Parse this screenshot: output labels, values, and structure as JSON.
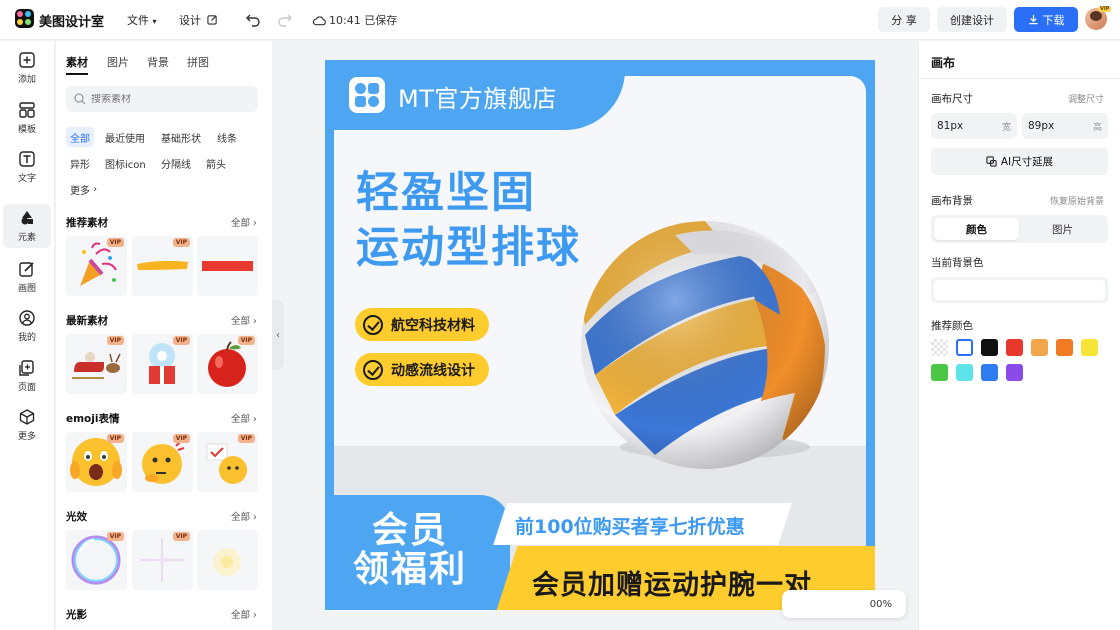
{
  "app": {
    "name": "美图设计室"
  },
  "topbar": {
    "file_menu": "文件",
    "design_menu": "设计",
    "save_status": "10:41 已保存",
    "share_label": "分 享",
    "create_label": "创建设计",
    "download_label": "下载",
    "avatar_badge": "VIP"
  },
  "rail": [
    {
      "label": "添加",
      "icon": "plus-square-icon"
    },
    {
      "label": "模板",
      "icon": "template-icon"
    },
    {
      "label": "文字",
      "icon": "text-icon"
    },
    {
      "label": "元素",
      "icon": "shapes-icon",
      "active": true
    },
    {
      "label": "画图",
      "icon": "draw-icon"
    },
    {
      "label": "我的",
      "icon": "user-icon"
    },
    {
      "label": "页面",
      "icon": "page-add-icon"
    },
    {
      "label": "更多",
      "icon": "cube-icon"
    }
  ],
  "panel": {
    "tabs": [
      "素材",
      "图片",
      "背景",
      "拼图"
    ],
    "search_placeholder": "搜索素材",
    "chips": [
      "全部",
      "最近使用",
      "基础形状",
      "线条",
      "异形",
      "图标icon",
      "分隔线",
      "箭头",
      "更多"
    ],
    "all_label": "全部",
    "vip_badge": "VIP",
    "sections": [
      {
        "title": "推荐素材"
      },
      {
        "title": "最新素材"
      },
      {
        "title": "emoji表情"
      },
      {
        "title": "光效"
      },
      {
        "title": "光影"
      }
    ]
  },
  "poster": {
    "store_name": "MT官方旗舰店",
    "headline_1": "轻盈坚固",
    "headline_2": "运动型排球",
    "feature_1": "航空科技材料",
    "feature_2": "动感流线设计",
    "promo_left": "会员\n领福利",
    "promo_top": "前100位购买者享七折优惠",
    "promo_bottom": "会员加赠运动护腕一对"
  },
  "zoom": {
    "value": "00%"
  },
  "props": {
    "title": "画布",
    "size_label": "画布尺寸",
    "size_link": "调整尺寸",
    "width_value": "81px",
    "width_unit": "宽",
    "height_value": "89px",
    "height_unit": "高",
    "ai_button": "AI尺寸延展",
    "bg_label": "画布背景",
    "bg_reset": "恢复原始背景",
    "seg_color": "颜色",
    "seg_image": "图片",
    "current_color_label": "当前背景色",
    "recommended_label": "推荐颜色",
    "swatches": [
      "transparent",
      "#ffffff",
      "#111111",
      "#e8392f",
      "#f2a64b",
      "#f07b22",
      "#f5e536",
      "#4cc645",
      "#5ce4e8",
      "#2f7bf0",
      "#8a4be8"
    ]
  },
  "colors": {
    "accent": "#2b6ff6",
    "poster_blue": "#4ea6f2",
    "poster_yellow": "#ffcc2e"
  }
}
